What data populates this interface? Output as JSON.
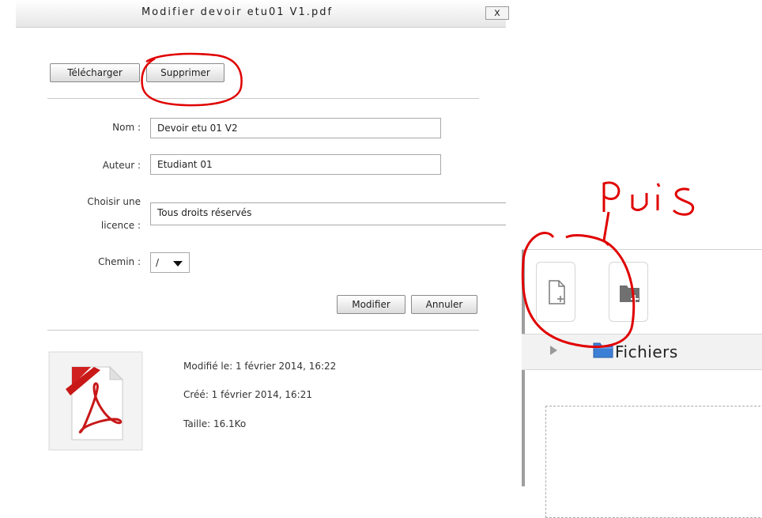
{
  "dialog": {
    "title": "Modifier devoir etu01 V1.pdf",
    "close_label": "x",
    "download_label": "Télécharger",
    "delete_label": "Supprimer",
    "name_label": "Nom :",
    "name_value": "Devoir etu 01 V2",
    "author_label": "Auteur :",
    "author_value": "Etudiant 01",
    "license_label_line1": "Choisir une",
    "license_label_line2": "licence :",
    "license_value": "Tous droits réservés",
    "path_label": "Chemin :",
    "path_value": "/",
    "update_label": "Modifier",
    "cancel_label": "Annuler",
    "modified": "Modifié le: 1 février 2014, 16:22",
    "created": "Créé: 1 février 2014, 16:21",
    "size": "Taille: 16.1Ko"
  },
  "annotation": {
    "text": "puis",
    "color": "#e00000"
  },
  "file_manager": {
    "folder_label": "Fichiers"
  },
  "icons": [
    "close-icon",
    "chevron-down-icon",
    "pdf-file-icon",
    "add-file-icon",
    "create-folder-icon",
    "expand-arrow-icon",
    "folder-icon"
  ]
}
